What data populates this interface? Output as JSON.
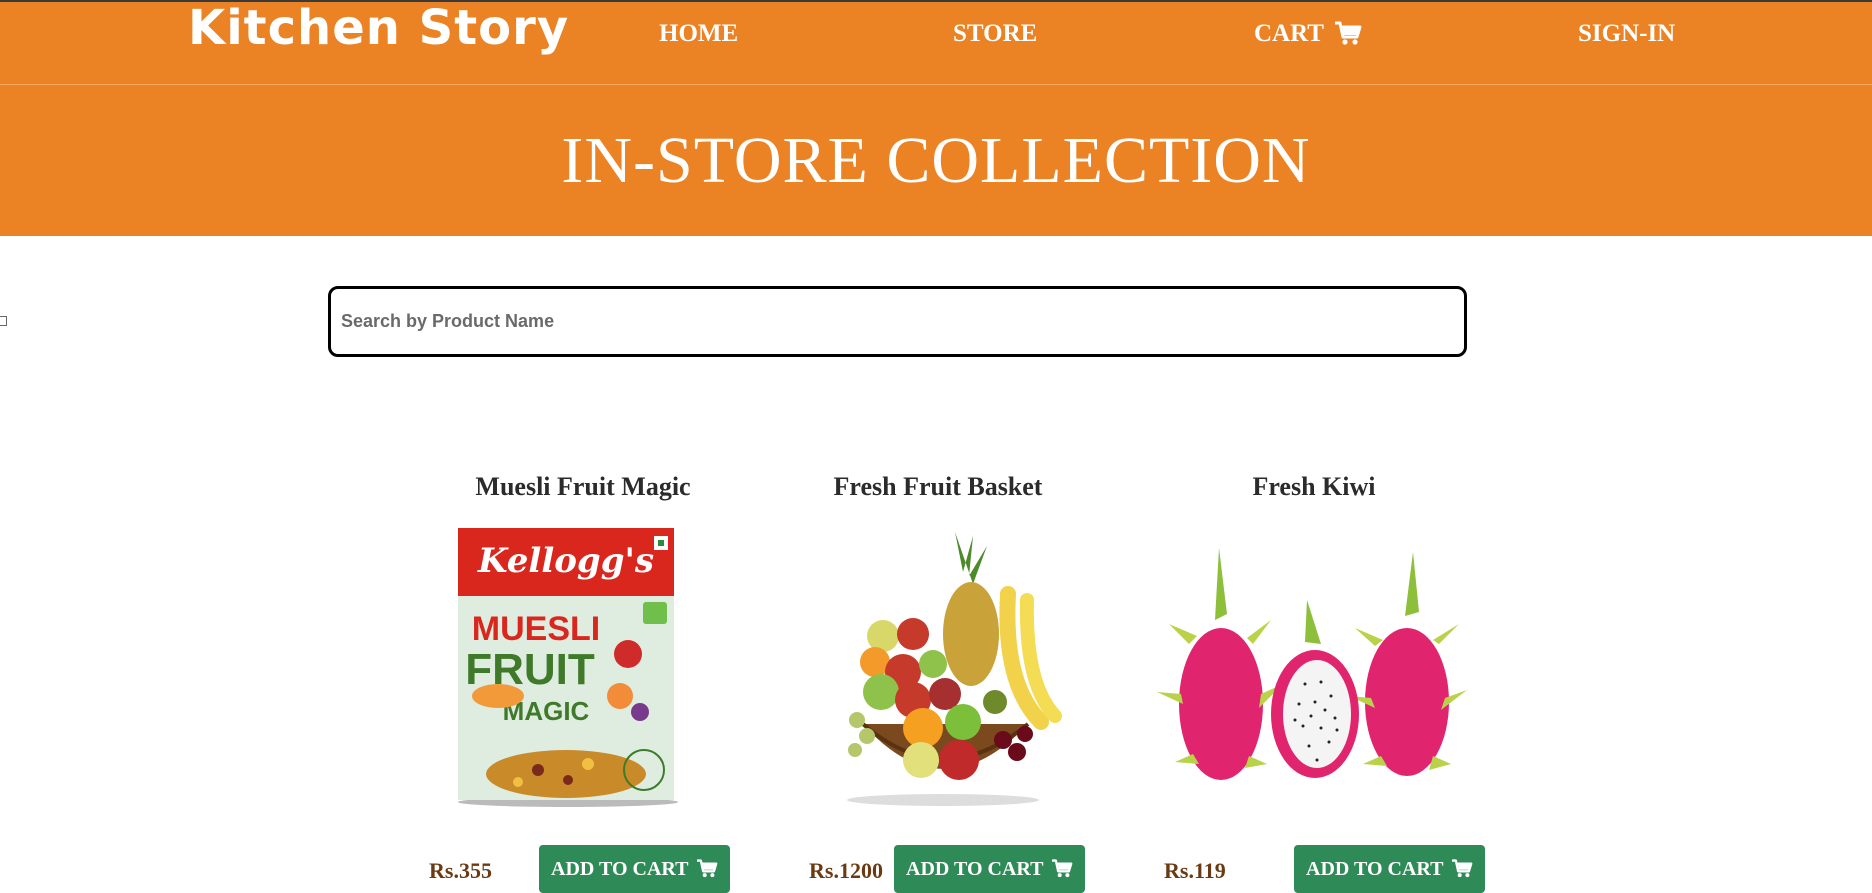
{
  "nav": {
    "brand": "Kitchen Story",
    "links": [
      "HOME",
      "STORE",
      "CART",
      "SIGN-IN"
    ]
  },
  "banner": {
    "title": "IN-STORE COLLECTION"
  },
  "search": {
    "placeholder": "Search by Product Name",
    "value": ""
  },
  "products": [
    {
      "name": "Muesli Fruit Magic",
      "price": "Rs.355",
      "button": "ADD TO CART",
      "image": "muesli-box"
    },
    {
      "name": "Fresh Fruit Basket",
      "price": "Rs.1200",
      "button": "ADD TO CART",
      "image": "fruit-basket"
    },
    {
      "name": "Fresh Kiwi",
      "price": "Rs.119",
      "button": "ADD TO CART",
      "image": "dragon-fruit"
    }
  ],
  "product_image_text": {
    "box_brand": "Kellogg's",
    "box_line1": "MUESLI",
    "box_line2": "FRUIT",
    "box_line3": "MAGIC"
  },
  "colors": {
    "accent": "#eb8224",
    "button": "#2e8b57",
    "price": "#6a3a12"
  },
  "icons": [
    "cart-icon"
  ]
}
